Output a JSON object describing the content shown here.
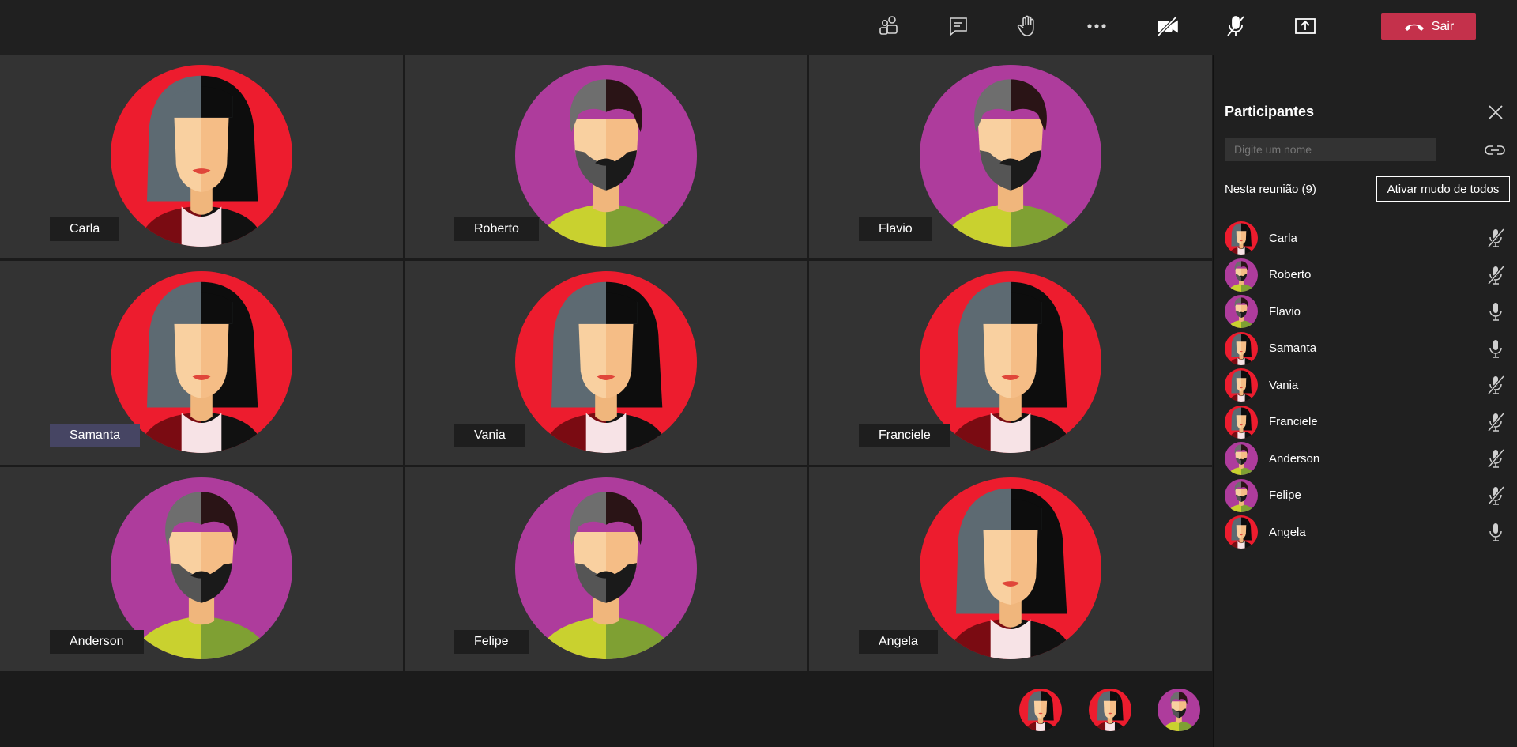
{
  "toolbar": {
    "leave_label": "Sair",
    "leave_color": "#c4314b"
  },
  "colors": {
    "female_bg": "#ed1c2e",
    "male_bg": "#ae3c9c",
    "tile_bg": "#333333",
    "highlight_tag": "#464563"
  },
  "tiles": [
    {
      "name": "Carla",
      "gender": "female"
    },
    {
      "name": "Roberto",
      "gender": "male"
    },
    {
      "name": "Flavio",
      "gender": "male"
    },
    {
      "name": "Samanta",
      "gender": "female",
      "highlighted": true
    },
    {
      "name": "Vania",
      "gender": "female"
    },
    {
      "name": "Franciele",
      "gender": "female"
    },
    {
      "name": "Anderson",
      "gender": "male"
    },
    {
      "name": "Felipe",
      "gender": "male"
    },
    {
      "name": "Angela",
      "gender": "female"
    }
  ],
  "strip": [
    "female",
    "female",
    "male"
  ],
  "panel": {
    "title": "Participantes",
    "search_placeholder": "Digite um nome",
    "meeting_count": "Nesta reunião (9)",
    "mute_all_label": "Ativar mudo de todos",
    "participants": [
      {
        "name": "Carla",
        "gender": "female",
        "muted": true
      },
      {
        "name": "Roberto",
        "gender": "male",
        "muted": true
      },
      {
        "name": "Flavio",
        "gender": "male",
        "muted": false
      },
      {
        "name": "Samanta",
        "gender": "female",
        "muted": false
      },
      {
        "name": "Vania",
        "gender": "female",
        "muted": true
      },
      {
        "name": "Franciele",
        "gender": "female",
        "muted": true
      },
      {
        "name": "Anderson",
        "gender": "male",
        "muted": true
      },
      {
        "name": "Felipe",
        "gender": "male",
        "muted": true
      },
      {
        "name": "Angela",
        "gender": "female",
        "muted": false
      }
    ]
  }
}
